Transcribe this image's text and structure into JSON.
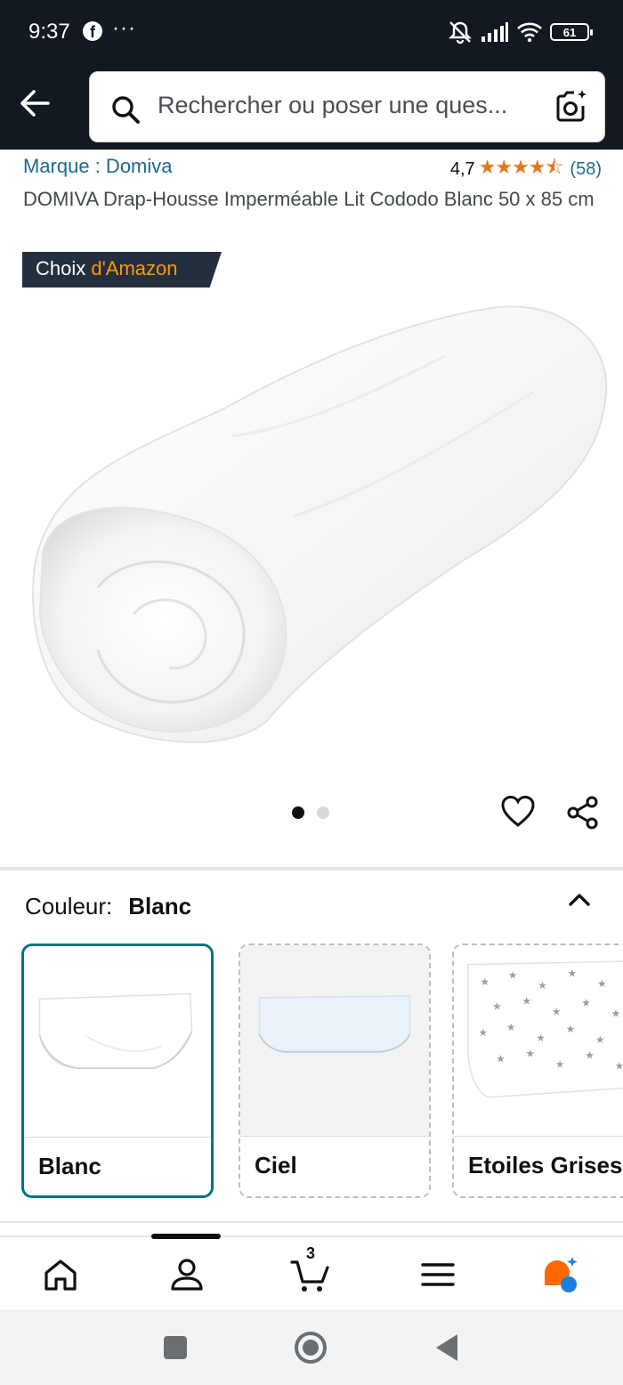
{
  "status_bar": {
    "time": "9:37",
    "facebook_icon": "f",
    "more": "···",
    "battery": "61"
  },
  "search": {
    "placeholder": "Rechercher ou poser une ques..."
  },
  "product": {
    "brand": "Marque : Domiva",
    "rating_value": "4,7",
    "rating_stars": 4.7,
    "rating_count": "(58)",
    "title": "DOMIVA Drap-Housse Imperméable Lit Cododo Blanc 50 x 85 cm",
    "badge_prefix": "Choix",
    "badge_brand": "d'Amazon",
    "image_count": 2,
    "image_index": 1
  },
  "color": {
    "label": "Couleur:",
    "selected": "Blanc"
  },
  "variants": [
    {
      "label": "Blanc",
      "selected": true
    },
    {
      "label": "Ciel",
      "selected": false
    },
    {
      "label": "Etoiles Grises",
      "selected": false
    }
  ],
  "nav": {
    "cart_count": "3"
  },
  "colors": {
    "header_bg": "#131921",
    "link": "#1b6a8f",
    "star": "#de7921",
    "badge_bg": "#232f3e",
    "badge_accent": "#ff9900",
    "selected_border": "#007185"
  }
}
